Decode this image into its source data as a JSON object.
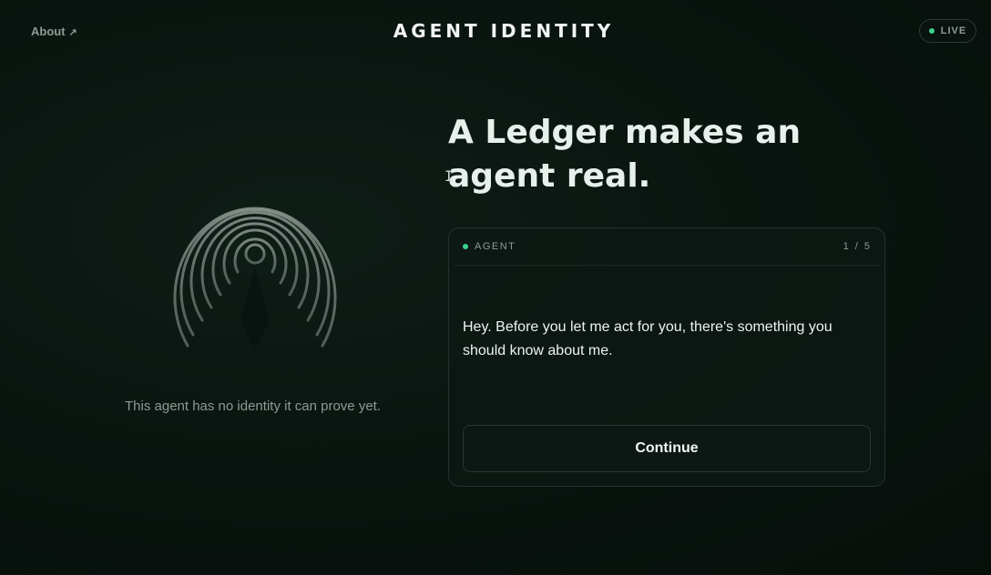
{
  "header": {
    "about_label": "About",
    "about_icon": "↗",
    "title": "AGENT IDENTITY",
    "live_label": "LIVE"
  },
  "left_panel": {
    "icon": "fingerprint-icon",
    "caption": "This agent has no identity it can prove yet."
  },
  "main": {
    "headline": "A Ledger makes an agent real."
  },
  "card": {
    "label": "AGENT",
    "step": "1 / 5",
    "message": "Hey. Before you let me act for you, there's something you should know about me.",
    "continue_label": "Continue"
  },
  "colors": {
    "accent": "#3fd08b",
    "background": "#0a1510",
    "fingerprint_stroke": "#7d8a84"
  }
}
